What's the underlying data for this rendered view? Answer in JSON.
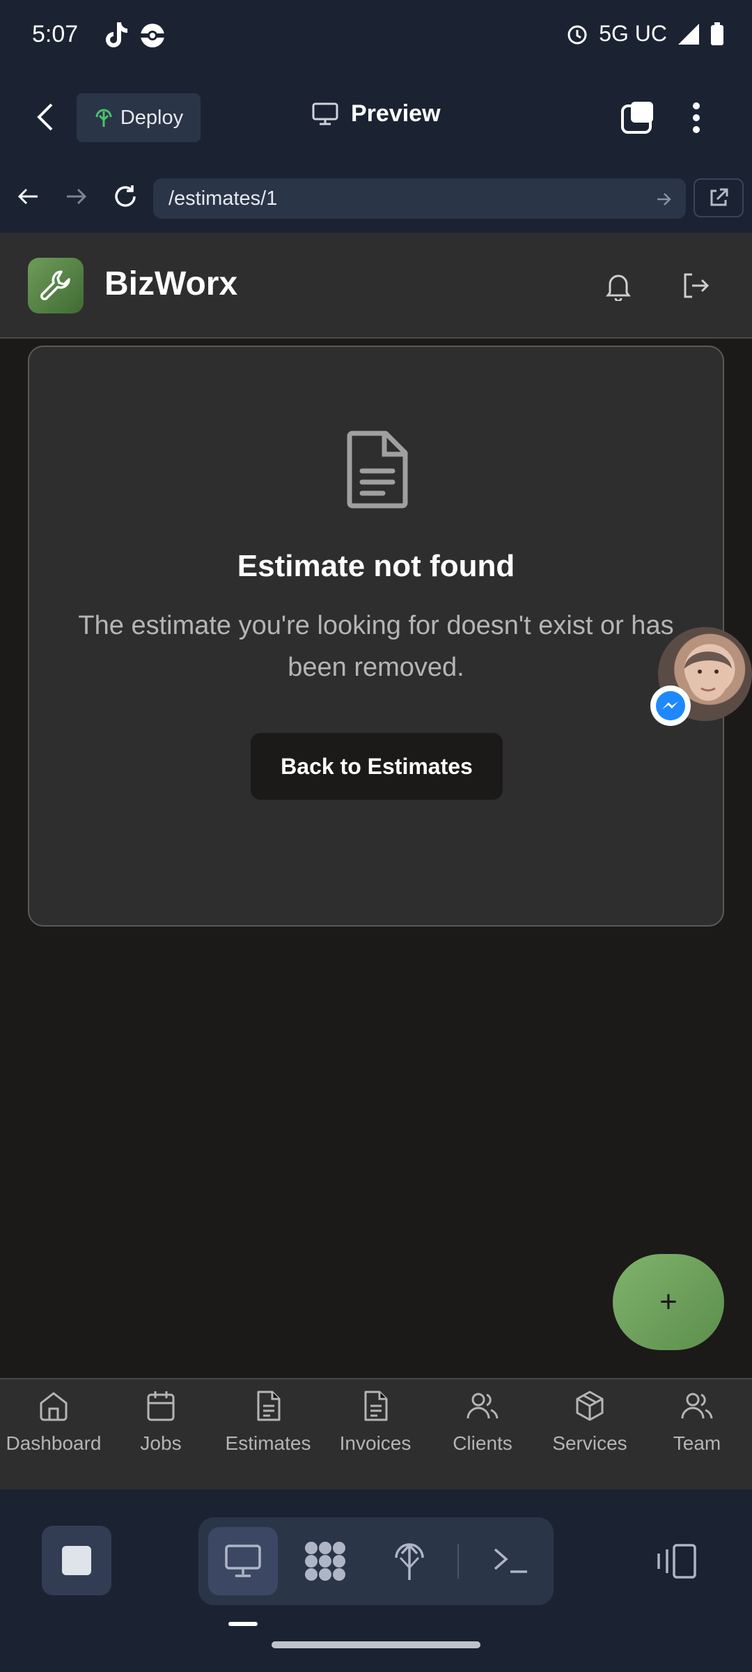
{
  "status_bar": {
    "time": "5:07",
    "network": "5G UC"
  },
  "app_bar": {
    "deploy_label": "Deploy",
    "title": "Preview"
  },
  "browser": {
    "url": "/estimates/1"
  },
  "header": {
    "brand": "BizWorx"
  },
  "card": {
    "title": "Estimate not found",
    "message": "The estimate you're looking for doesn't exist or has been removed.",
    "button_label": "Back to Estimates"
  },
  "fab": {
    "icon": "plus-icon",
    "label": "+"
  },
  "bottom_nav": {
    "items": [
      {
        "label": "Dashboard",
        "icon": "home-icon"
      },
      {
        "label": "Jobs",
        "icon": "calendar-icon"
      },
      {
        "label": "Estimates",
        "icon": "document-icon"
      },
      {
        "label": "Invoices",
        "icon": "document-icon"
      },
      {
        "label": "Clients",
        "icon": "users-icon"
      },
      {
        "label": "Services",
        "icon": "box-icon"
      },
      {
        "label": "Team",
        "icon": "users-icon"
      }
    ]
  },
  "colors": {
    "accent": "#6f9c5a",
    "background": "#1c1a19",
    "surface": "#2e2e2e",
    "chrome": "#1b2333"
  }
}
